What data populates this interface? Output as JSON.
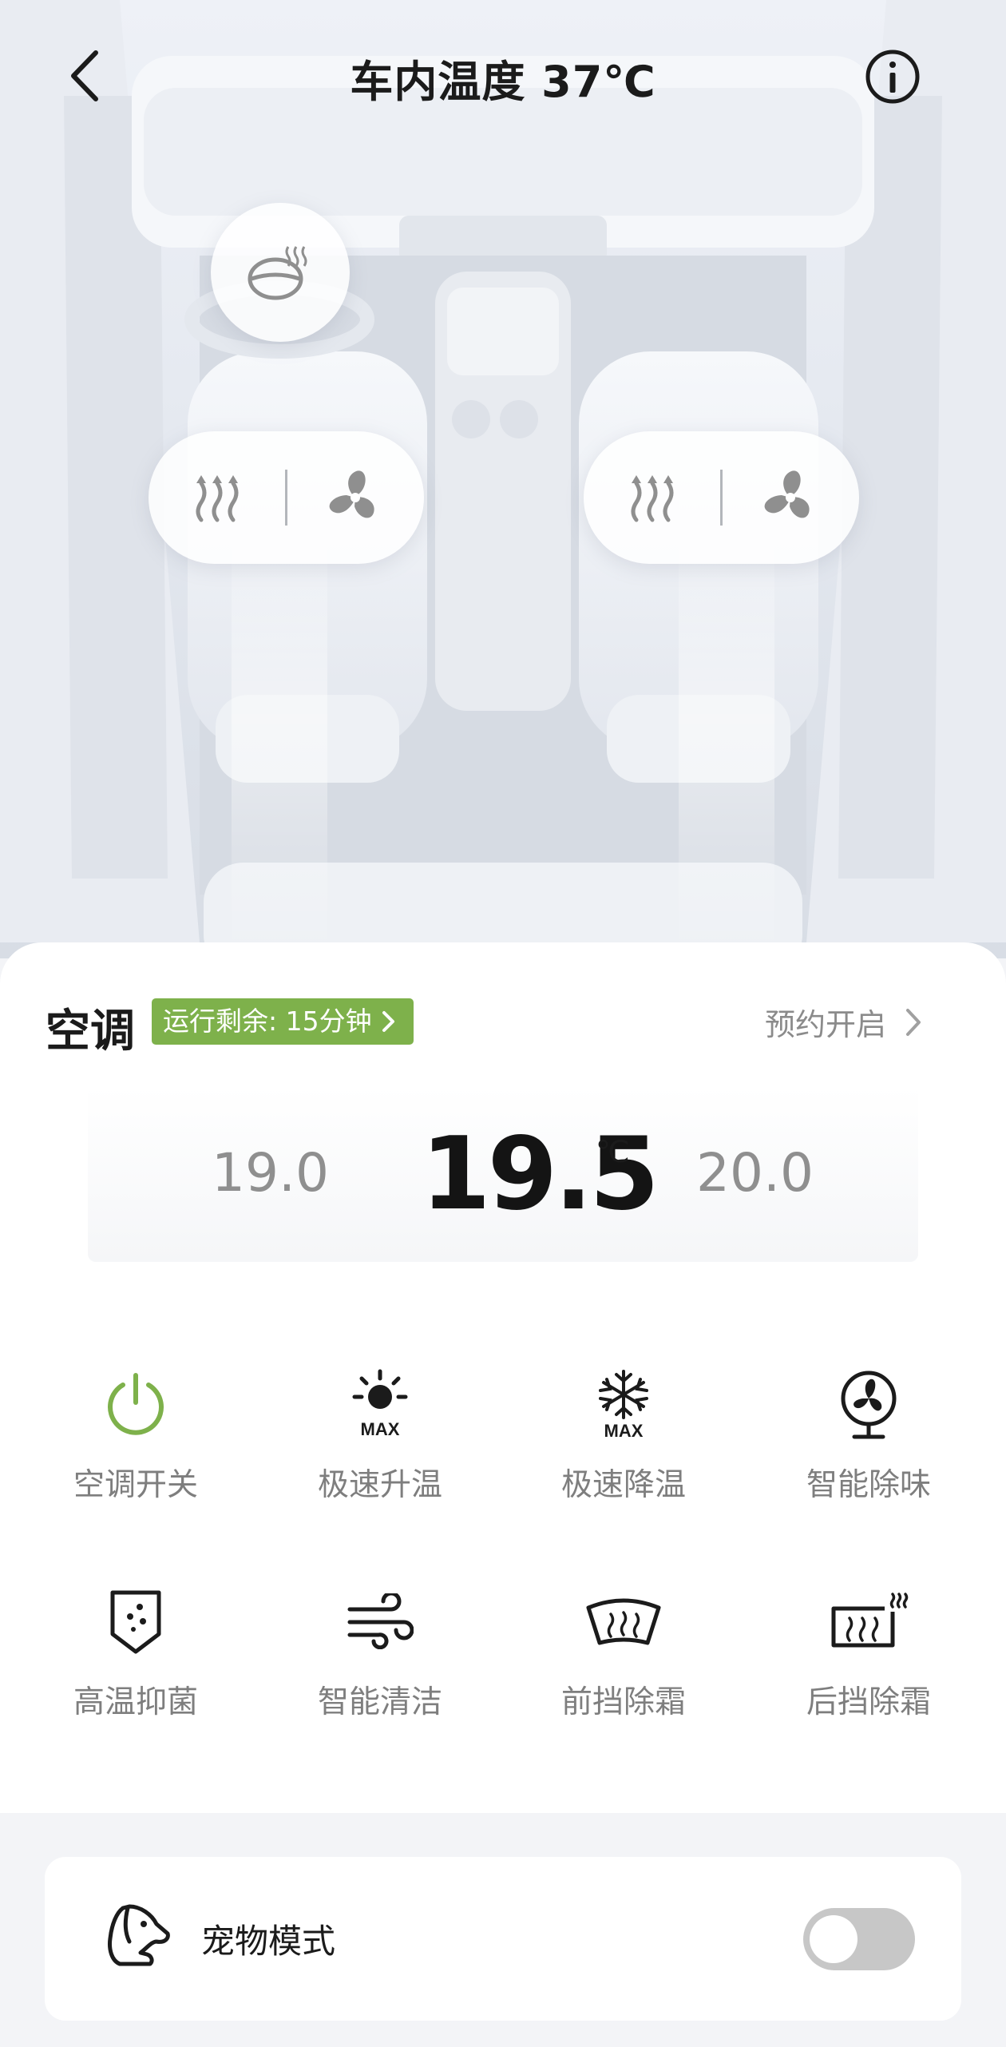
{
  "header": {
    "title": "车内温度 37℃",
    "back_icon": "chevron-left-icon",
    "info_icon": "info-icon"
  },
  "seat_controls": {
    "steering_wheel": {
      "icon": "steering-wheel-heat-icon"
    },
    "driver_seat": {
      "heat_icon": "seat-heat-icon",
      "vent_icon": "seat-fan-icon"
    },
    "passenger_seat": {
      "heat_icon": "seat-heat-icon",
      "vent_icon": "seat-fan-icon"
    }
  },
  "ac": {
    "title": "空调",
    "remaining": "运行剩余: 15分钟",
    "schedule": "预约开启",
    "temp_prev": "19.0",
    "temp_current": "19.5",
    "temp_unit": "℃",
    "temp_next": "20.0",
    "accent_color": "#7eb14b"
  },
  "functions": [
    {
      "label": "空调开关",
      "icon": "power-icon"
    },
    {
      "label": "极速升温",
      "icon": "sun-max-icon"
    },
    {
      "label": "极速降温",
      "icon": "snowflake-max-icon"
    },
    {
      "label": "智能除味",
      "icon": "fan-icon"
    },
    {
      "label": "高温抑菌",
      "icon": "shield-dots-icon"
    },
    {
      "label": "智能清洁",
      "icon": "wind-icon"
    },
    {
      "label": "前挡除霜",
      "icon": "front-defrost-icon"
    },
    {
      "label": "后挡除霜",
      "icon": "rear-defrost-icon"
    }
  ],
  "pet_mode": {
    "label": "宠物模式",
    "icon": "dog-icon",
    "enabled": false
  }
}
